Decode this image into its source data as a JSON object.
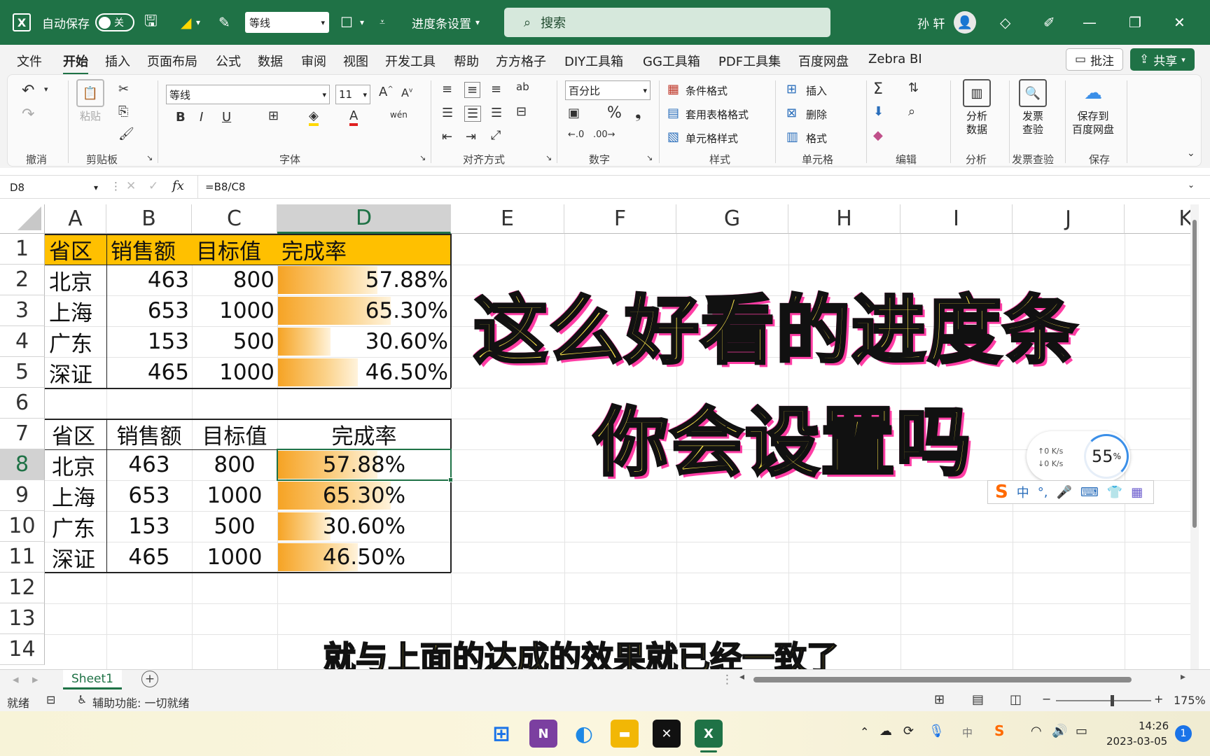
{
  "titlebar": {
    "autosave_label": "自动保存",
    "autosave_state": "关",
    "font_name": "等线",
    "filename": "进度条设置",
    "search_placeholder": "搜索",
    "user_name": "孙 轩"
  },
  "menu": {
    "items": [
      "文件",
      "开始",
      "插入",
      "页面布局",
      "公式",
      "数据",
      "审阅",
      "视图",
      "开发工具",
      "帮助",
      "方方格子",
      "DIY工具箱",
      "GG工具箱",
      "PDF工具集",
      "百度网盘",
      "Zebra BI"
    ],
    "active": "开始",
    "comment_btn": "批注",
    "share_btn": "共享"
  },
  "ribbon": {
    "groups": {
      "undo": "撤消",
      "clipboard": "剪贴板",
      "font": "字体",
      "align": "对齐方式",
      "number": "数字",
      "styles": "样式",
      "cells": "单元格",
      "edit": "编辑",
      "analyze": "分析",
      "invoice": "发票查验",
      "save": "保存"
    },
    "paste": "粘贴",
    "font_name": "等线",
    "font_size": "11",
    "number_format": "百分比",
    "cond_format": "条件格式",
    "table_format": "套用表格格式",
    "cell_style": "单元格样式",
    "insert": "插入",
    "delete": "删除",
    "format": "格式",
    "analyze_btn": "分析\n数据",
    "analyze_btn_l1": "分析",
    "analyze_btn_l2": "数据",
    "invoice_l1": "发票",
    "invoice_l2": "查验",
    "baidu_l1": "保存到",
    "baidu_l2": "百度网盘"
  },
  "formula_bar": {
    "name_box": "D8",
    "formula": "=B8/C8"
  },
  "columns": [
    "A",
    "B",
    "C",
    "D",
    "E",
    "F",
    "G",
    "H",
    "I",
    "J",
    "K"
  ],
  "rows": [
    "1",
    "2",
    "3",
    "4",
    "5",
    "6",
    "7",
    "8",
    "9",
    "10",
    "11",
    "12",
    "13",
    "14"
  ],
  "selected_cell": "D8",
  "table1": {
    "headers": [
      "省区",
      "销售额",
      "目标值",
      "完成率"
    ],
    "rows": [
      {
        "region": "北京",
        "sales": "463",
        "target": "800",
        "rate": "57.88%",
        "frac": 0.5788
      },
      {
        "region": "上海",
        "sales": "653",
        "target": "1000",
        "rate": "65.30%",
        "frac": 0.653
      },
      {
        "region": "广东",
        "sales": "153",
        "target": "500",
        "rate": "30.60%",
        "frac": 0.306
      },
      {
        "region": "深证",
        "sales": "465",
        "target": "1000",
        "rate": "46.50%",
        "frac": 0.465
      }
    ]
  },
  "table2": {
    "headers": [
      "省区",
      "销售额",
      "目标值",
      "完成率"
    ],
    "rows": [
      {
        "region": "北京",
        "sales": "463",
        "target": "800",
        "rate": "57.88%",
        "frac": 0.5788
      },
      {
        "region": "上海",
        "sales": "653",
        "target": "1000",
        "rate": "65.30%",
        "frac": 0.653
      },
      {
        "region": "广东",
        "sales": "153",
        "target": "500",
        "rate": "30.60%",
        "frac": 0.306
      },
      {
        "region": "深证",
        "sales": "465",
        "target": "1000",
        "rate": "46.50%",
        "frac": 0.465
      }
    ]
  },
  "overlay": {
    "title_line1": "这么好看的进度条",
    "title_line2": "你会设置吗",
    "subtitle": "就与上面的达成的效果就已经一致了"
  },
  "widget": {
    "up_speed": "0 K/s",
    "down_speed": "0 K/s",
    "percent": "55",
    "percent_sign": "%",
    "ime_lang": "中"
  },
  "sheet_tab": "Sheet1",
  "status": {
    "ready": "就绪",
    "accessibility": "辅助功能: 一切就绪",
    "zoom": "175%"
  },
  "taskbar": {
    "time": "14:26",
    "date": "2023-03-05",
    "notif_count": "1",
    "ime": "中"
  },
  "colors": {
    "excel_green": "#1f7246",
    "header_fill": "#ffc000",
    "bar_start": "#f6a324",
    "title_yellow": "#ffe84a",
    "title_pink": "#ff3ea5"
  }
}
